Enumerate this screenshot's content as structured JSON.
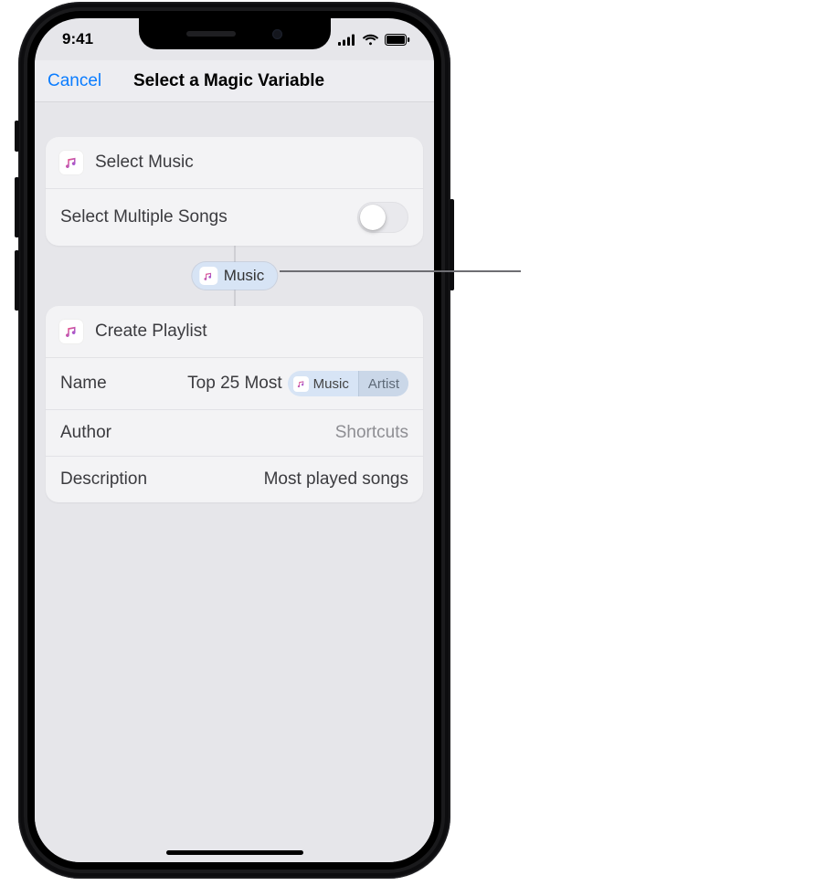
{
  "status": {
    "time": "9:41"
  },
  "nav": {
    "cancel_label": "Cancel",
    "title": "Select a Magic Variable"
  },
  "action1": {
    "title": "Select Music",
    "toggle_label": "Select Multiple Songs",
    "toggle_on": false
  },
  "magic_pill": {
    "label": "Music"
  },
  "action2": {
    "title": "Create Playlist",
    "rows": {
      "name_label": "Name",
      "name_text": "Top 25 Most",
      "name_token_main": "Music",
      "name_token_sub": "Artist",
      "author_label": "Author",
      "author_value": "Shortcuts",
      "description_label": "Description",
      "description_value": "Most played songs"
    }
  }
}
